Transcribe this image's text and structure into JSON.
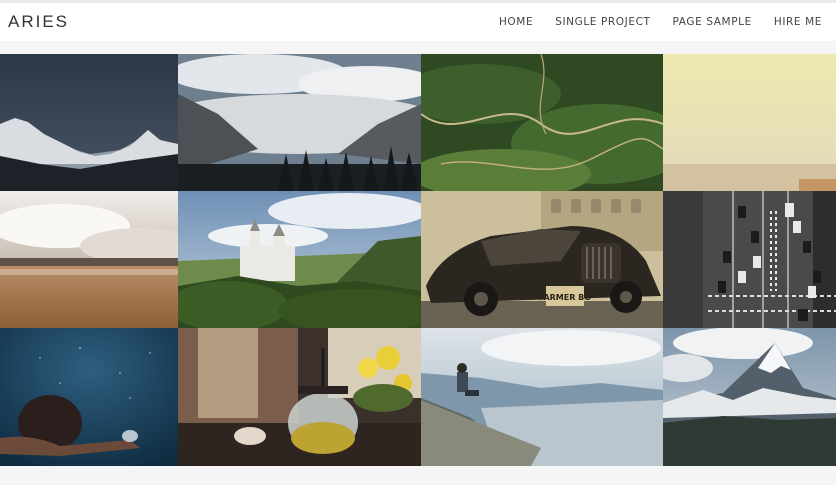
{
  "site": {
    "logo": "ARIES"
  },
  "nav": {
    "items": [
      {
        "label": "HOME"
      },
      {
        "label": "SINGLE PROJECT"
      },
      {
        "label": "PAGE SAMPLE"
      },
      {
        "label": "HIRE ME"
      }
    ]
  },
  "gallery": {
    "tiles": [
      {
        "subject": "snowy mountain ridge at dusk"
      },
      {
        "subject": "misty forest valley under clouds"
      },
      {
        "subject": "aerial green hills with winding road"
      },
      {
        "subject": "pale hazy desert sky"
      },
      {
        "subject": "cloudy sky over calm brown lake"
      },
      {
        "subject": "castle on forested hill"
      },
      {
        "subject": "vintage car on street"
      },
      {
        "subject": "aerial city street with traffic"
      },
      {
        "subject": "person swimming underwater"
      },
      {
        "subject": "tea pot and cup with yellow flowers"
      },
      {
        "subject": "man sitting on stone wall overlooking valley"
      },
      {
        "subject": "snowy mountain peak under clouds"
      }
    ],
    "car_plate": "FARMER BO"
  }
}
